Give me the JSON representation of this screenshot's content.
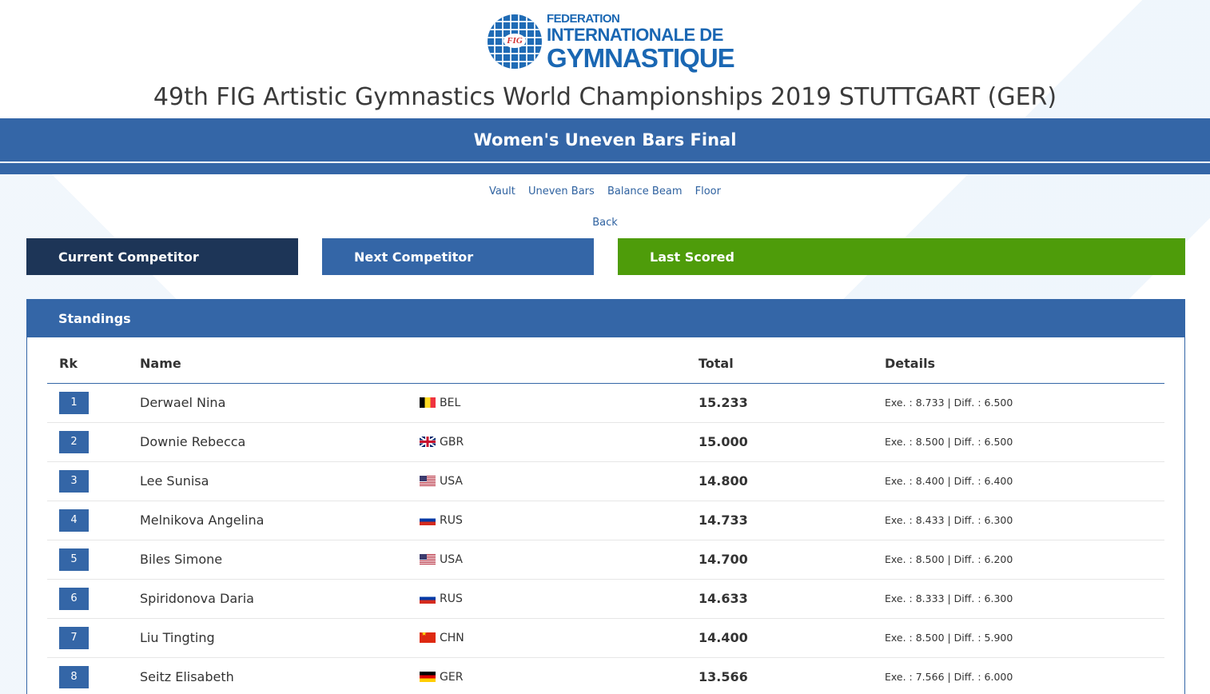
{
  "header": {
    "logo": {
      "line1": "FEDERATION",
      "line2": "INTERNATIONALE DE",
      "line3": "GYMNASTIQUE",
      "emblem": "FIG"
    },
    "event_title": "49th FIG Artistic Gymnastics World Championships 2019 STUTTGART (GER)"
  },
  "final_title": "Women's Uneven Bars Final",
  "nav": {
    "items": [
      "Vault",
      "Uneven Bars",
      "Balance Beam",
      "Floor"
    ],
    "back": "Back"
  },
  "panels": {
    "current": "Current Competitor",
    "next": "Next Competitor",
    "last": "Last Scored"
  },
  "standings": {
    "title": "Standings",
    "columns": {
      "rank": "Rk",
      "name": "Name",
      "total": "Total",
      "details": "Details"
    },
    "rows": [
      {
        "rank": "1",
        "name": "Derwael Nina",
        "nation": "BEL",
        "flag": "f-bel",
        "total": "15.233",
        "details": "Exe. : 8.733 | Diff. : 6.500"
      },
      {
        "rank": "2",
        "name": "Downie Rebecca",
        "nation": "GBR",
        "flag": "f-gbr",
        "total": "15.000",
        "details": "Exe. : 8.500 | Diff. : 6.500"
      },
      {
        "rank": "3",
        "name": "Lee Sunisa",
        "nation": "USA",
        "flag": "f-usa",
        "total": "14.800",
        "details": "Exe. : 8.400 | Diff. : 6.400"
      },
      {
        "rank": "4",
        "name": "Melnikova Angelina",
        "nation": "RUS",
        "flag": "f-rus",
        "total": "14.733",
        "details": "Exe. : 8.433 | Diff. : 6.300"
      },
      {
        "rank": "5",
        "name": "Biles Simone",
        "nation": "USA",
        "flag": "f-usa",
        "total": "14.700",
        "details": "Exe. : 8.500 | Diff. : 6.200"
      },
      {
        "rank": "6",
        "name": "Spiridonova Daria",
        "nation": "RUS",
        "flag": "f-rus",
        "total": "14.633",
        "details": "Exe. : 8.333 | Diff. : 6.300"
      },
      {
        "rank": "7",
        "name": "Liu Tingting",
        "nation": "CHN",
        "flag": "f-chn",
        "total": "14.400",
        "details": "Exe. : 8.500 | Diff. : 5.900"
      },
      {
        "rank": "8",
        "name": "Seitz Elisabeth",
        "nation": "GER",
        "flag": "f-ger",
        "total": "13.566",
        "details": "Exe. : 7.566 | Diff. : 6.000"
      }
    ]
  },
  "colors": {
    "primary_blue": "#3466a7",
    "dark_navy": "#1d3557",
    "green": "#4e9c0a",
    "link_blue": "#2f62a0"
  }
}
